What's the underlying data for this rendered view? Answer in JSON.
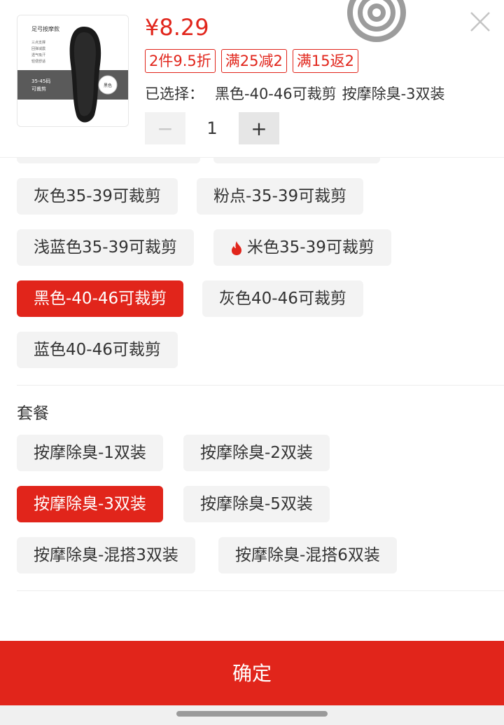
{
  "product": {
    "thumb_title": "足弓按摩款",
    "thumb_features": [
      "三点支撑",
      "回弹减震",
      "透气吸汗",
      "轻便舒适"
    ],
    "thumb_size": "35-45码",
    "thumb_cut": "可裁剪",
    "thumb_color": "黑色",
    "price": "¥8.29",
    "promos": [
      "2件9.5折",
      "满25减2",
      "满15返2"
    ],
    "selected_label": "已选择：",
    "selected_color": "黑色-40-46可裁剪",
    "selected_pack": "按摩除臭-3双装",
    "quantity": "1",
    "minus": "−",
    "plus": "+"
  },
  "colors": {
    "items": [
      {
        "label": "灰色35-39可裁剪",
        "selected": false,
        "hot": false
      },
      {
        "label": "粉点-35-39可裁剪",
        "selected": false,
        "hot": false
      },
      {
        "label": "浅蓝色35-39可裁剪",
        "selected": false,
        "hot": false
      },
      {
        "label": "米色35-39可裁剪",
        "selected": false,
        "hot": true
      },
      {
        "label": "黑色-40-46可裁剪",
        "selected": true,
        "hot": false
      },
      {
        "label": "灰色40-46可裁剪",
        "selected": false,
        "hot": false
      },
      {
        "label": "蓝色40-46可裁剪",
        "selected": false,
        "hot": false
      }
    ]
  },
  "package": {
    "title": "套餐",
    "items": [
      {
        "label": "按摩除臭-1双装",
        "selected": false
      },
      {
        "label": "按摩除臭-2双装",
        "selected": false
      },
      {
        "label": "按摩除臭-3双装",
        "selected": true
      },
      {
        "label": "按摩除臭-5双装",
        "selected": false
      },
      {
        "label": "按摩除臭-混搭3双装",
        "selected": false
      },
      {
        "label": "按摩除臭-混搭6双装",
        "selected": false
      }
    ]
  },
  "confirm_label": "确定",
  "theme": {
    "accent": "#e1251b",
    "chip_bg": "#f3f3f3"
  }
}
